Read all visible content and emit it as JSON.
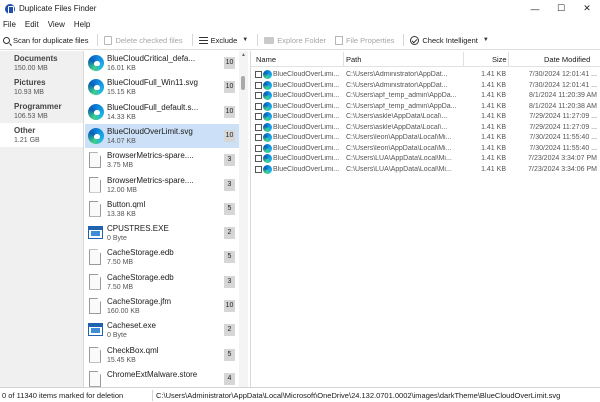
{
  "window": {
    "title": "Duplicate Files Finder",
    "controls": [
      "—",
      "☐",
      "✕"
    ]
  },
  "menu": [
    "File",
    "Edit",
    "View",
    "Help"
  ],
  "toolbar": {
    "scan_label": "Scan for duplicate files",
    "delete_label": "Delete checked files",
    "exclude_label": "Exclude",
    "explore_label": "Explore Folder",
    "properties_label": "File Properties",
    "check_label": "Check Intelligent",
    "dropdown_caret": "▼"
  },
  "categories": [
    {
      "name": "Documents",
      "size": "150.00 MB",
      "selected": false
    },
    {
      "name": "Pictures",
      "size": "10.93 MB",
      "selected": false
    },
    {
      "name": "Programmer",
      "size": "106.53 MB",
      "selected": false
    },
    {
      "name": "Other",
      "size": "1.21 GB",
      "selected": true
    }
  ],
  "groups": [
    {
      "name": "BlueCloudCritical_defa...",
      "size": "16.01 KB",
      "count": "10",
      "icon": "edge-icon",
      "selected": false
    },
    {
      "name": "BlueCloudFull_Win11.svg",
      "size": "15.15 KB",
      "count": "10",
      "icon": "edge-icon",
      "selected": false
    },
    {
      "name": "BlueCloudFull_default.s...",
      "size": "14.33 KB",
      "count": "10",
      "icon": "edge-icon",
      "selected": false
    },
    {
      "name": "BlueCloudOverLimit.svg",
      "size": "14.07 KB",
      "count": "10",
      "icon": "edge-icon",
      "selected": true
    },
    {
      "name": "BrowserMetrics-spare....",
      "size": "3.75 MB",
      "count": "3",
      "icon": "file-icon",
      "selected": false
    },
    {
      "name": "BrowserMetrics-spare....",
      "size": "12.00 MB",
      "count": "3",
      "icon": "file-icon",
      "selected": false
    },
    {
      "name": "Button.qml",
      "size": "13.38 KB",
      "count": "5",
      "icon": "file-icon",
      "selected": false
    },
    {
      "name": "CPUSTRES.EXE",
      "size": "0 Byte",
      "count": "2",
      "icon": "exe-icon",
      "selected": false
    },
    {
      "name": "CacheStorage.edb",
      "size": "7.50 MB",
      "count": "5",
      "icon": "file-icon",
      "selected": false
    },
    {
      "name": "CacheStorage.edb",
      "size": "7.50 MB",
      "count": "3",
      "icon": "file-icon",
      "selected": false
    },
    {
      "name": "CacheStorage.jfm",
      "size": "160.00 KB",
      "count": "10",
      "icon": "file-icon",
      "selected": false
    },
    {
      "name": "Cacheset.exe",
      "size": "0 Byte",
      "count": "2",
      "icon": "exe-icon",
      "selected": false
    },
    {
      "name": "CheckBox.qml",
      "size": "15.45 KB",
      "count": "5",
      "icon": "file-icon",
      "selected": false
    },
    {
      "name": "ChromeExtMalware.store",
      "size": "",
      "count": "4",
      "icon": "file-icon",
      "selected": false
    }
  ],
  "list": {
    "headers": {
      "name": "Name",
      "path": "Path",
      "size": "Size",
      "date": "Date Modified"
    },
    "rows": [
      {
        "name": "BlueCloudOverLimi...",
        "path": "C:\\Users\\Administrator\\AppDat...",
        "size": "1.41 KB",
        "date": "7/30/2024 12:01:41 ..."
      },
      {
        "name": "BlueCloudOverLimi...",
        "path": "C:\\Users\\Administrator\\AppDat...",
        "size": "1.41 KB",
        "date": "7/30/2024 12:01:41 ..."
      },
      {
        "name": "BlueCloudOverLimi...",
        "path": "C:\\Users\\apf_temp_admin\\AppDa...",
        "size": "1.41 KB",
        "date": "8/1/2024 11:20:39 AM"
      },
      {
        "name": "BlueCloudOverLimi...",
        "path": "C:\\Users\\apf_temp_admin\\AppDa...",
        "size": "1.41 KB",
        "date": "8/1/2024 11:20:38 AM"
      },
      {
        "name": "BlueCloudOverLimi...",
        "path": "C:\\Users\\askle\\AppData\\Local\\...",
        "size": "1.41 KB",
        "date": "7/29/2024 11:27:09 ..."
      },
      {
        "name": "BlueCloudOverLimi...",
        "path": "C:\\Users\\askle\\AppData\\Local\\...",
        "size": "1.41 KB",
        "date": "7/29/2024 11:27:09 ..."
      },
      {
        "name": "BlueCloudOverLimi...",
        "path": "C:\\Users\\leon\\AppData\\Local\\Mi...",
        "size": "1.41 KB",
        "date": "7/30/2024 11:55:40 ..."
      },
      {
        "name": "BlueCloudOverLimi...",
        "path": "C:\\Users\\leon\\AppData\\Local\\Mi...",
        "size": "1.41 KB",
        "date": "7/30/2024 11:55:40 ..."
      },
      {
        "name": "BlueCloudOverLimi...",
        "path": "C:\\Users\\LUA\\AppData\\Local\\Mi...",
        "size": "1.41 KB",
        "date": "7/23/2024 3:34:07 PM"
      },
      {
        "name": "BlueCloudOverLimi...",
        "path": "C:\\Users\\LUA\\AppData\\Local\\Mi...",
        "size": "1.41 KB",
        "date": "7/23/2024 3:34:06 PM"
      }
    ]
  },
  "status": {
    "left": "0 of 11340 items marked for deletion",
    "path": "C:\\Users\\Administrator\\AppData\\Local\\Microsoft\\OneDrive\\24.132.0701.0002\\images\\darkTheme\\BlueCloudOverLimit.svg"
  }
}
